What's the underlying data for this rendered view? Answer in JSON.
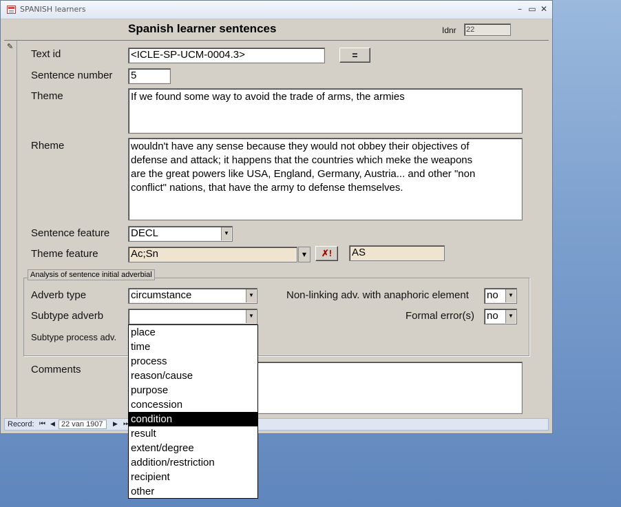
{
  "window": {
    "title": "SPANISH learners",
    "min": "–",
    "max": "▭",
    "close": "✕"
  },
  "form": {
    "title": "Spanish learner sentences",
    "idnr_label": "Idnr",
    "idnr_value": "22",
    "text_id_label": "Text id",
    "text_id_value": "<ICLE-SP-UCM-0004.3>",
    "equals_button": "=",
    "sentence_number_label": "Sentence number",
    "sentence_number_value": "5",
    "theme_label": "Theme",
    "theme_value": "If we found some way to avoid the trade of arms, the armies",
    "rheme_label": "Rheme",
    "rheme_lines": [
      "wouldn't have any sense because they would not obbey their objectives of",
      "defense and attack; it happens that the countries which meke the weapons",
      "are the great powers like USA, England, Germany, Austria... and other \"non",
      "conflict\" nations, that have the army to defense themselves."
    ],
    "sentence_feature_label": "Sentence feature",
    "sentence_feature_value": "DECL",
    "theme_feature_label": "Theme feature",
    "theme_feature_value": "Ac;Sn",
    "theme_feature_code": "AS",
    "clear_button": "✗!",
    "group_caption": "Analysis of sentence initial adverbial",
    "adverb_type_label": "Adverb type",
    "adverb_type_value": "circumstance",
    "subtype_adverb_label": "Subtype adverb",
    "subtype_adverb_value": "",
    "subtype_process_label": "Subtype process adv.",
    "non_linking_label": "Non-linking adv. with anaphoric element",
    "non_linking_value": "no",
    "formal_error_label": "Formal error(s)",
    "formal_error_value": "no",
    "comments_label": "Comments",
    "comments_value": ""
  },
  "dropdown": {
    "options": [
      "place",
      "time",
      "process",
      "reason/cause",
      "purpose",
      "concession",
      "condition",
      "result",
      "extent/degree",
      "addition/restriction",
      "recipient",
      "other"
    ],
    "selected": "condition"
  },
  "statusbar": {
    "record_label": "Record:",
    "record_value": "22 van 1907",
    "first": "⏮",
    "prev": "◀",
    "next": "▶",
    "last": "⏭"
  },
  "colors": {
    "desktop": "#7fa2cf",
    "form_bg": "#d4d0c8",
    "highlight": "#000000",
    "tan_field": "#efe4cf"
  }
}
